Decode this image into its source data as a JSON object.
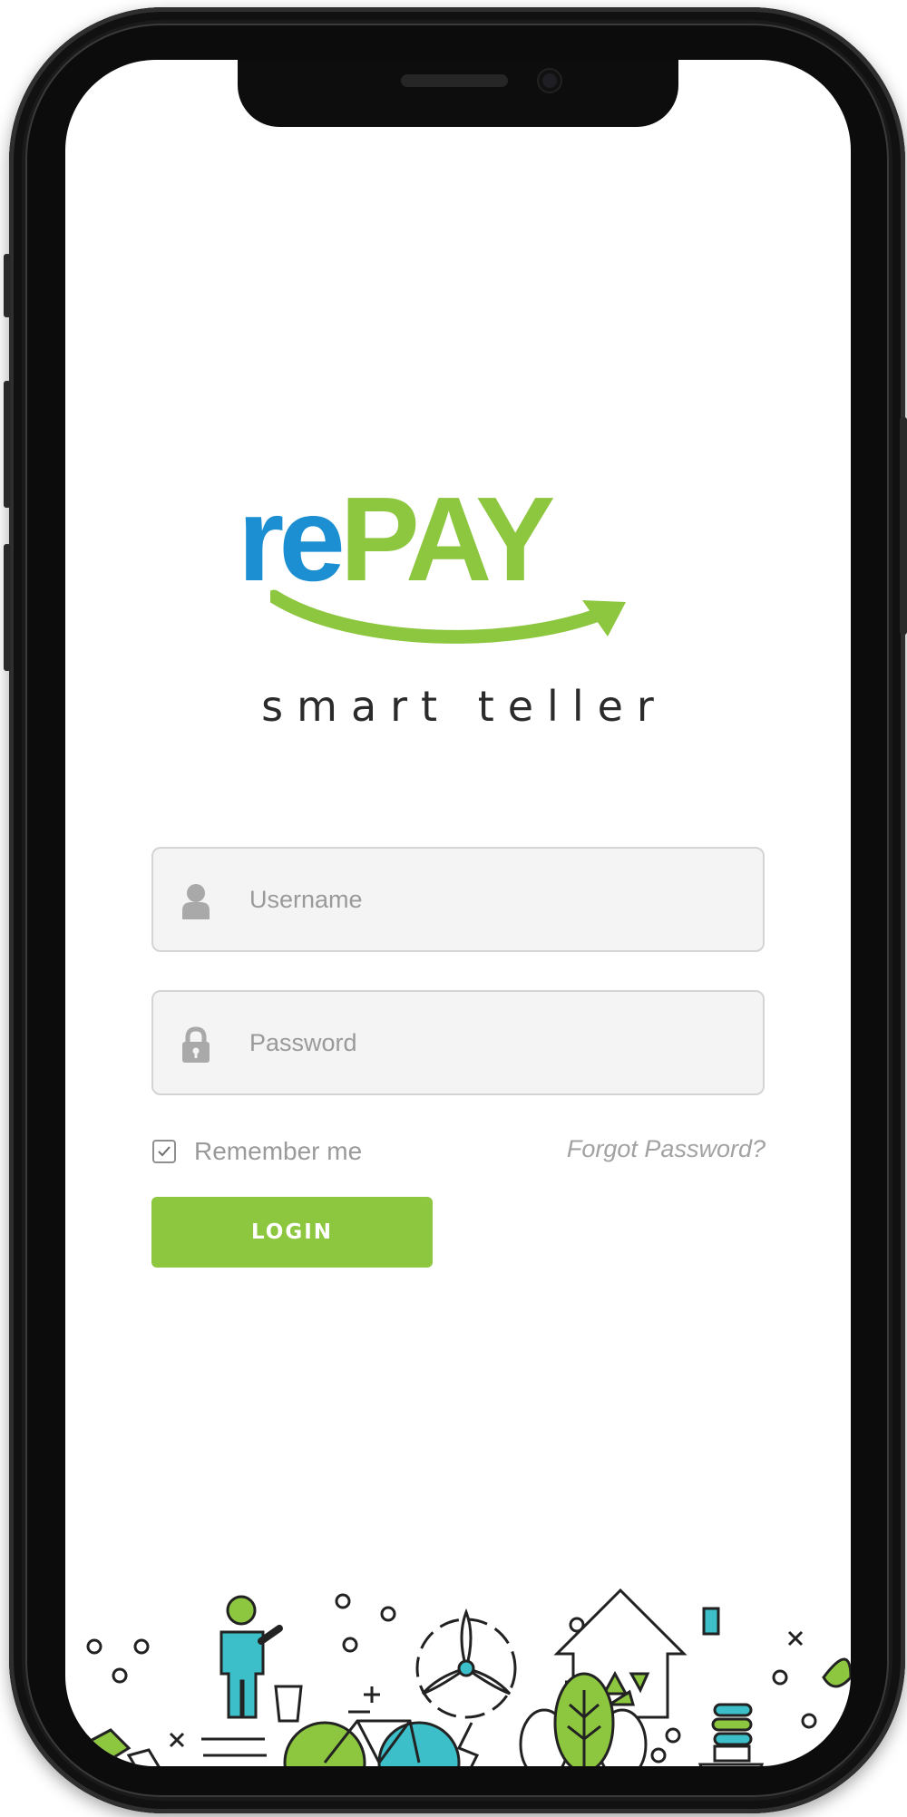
{
  "app": {
    "logo_text": "rePAY",
    "tagline": "smart teller"
  },
  "login_form": {
    "username": {
      "placeholder": "Username",
      "value": "",
      "icon": "user-icon"
    },
    "password": {
      "placeholder": "Password",
      "value": "",
      "icon": "lock-icon"
    },
    "remember_me": {
      "label": "Remember me",
      "checked": true
    },
    "forgot_password_label": "Forgot Password?",
    "login_label": "LOGIN"
  },
  "theme": {
    "blue": "#1b8fd2",
    "green": "#8dc63f",
    "teal": "#3cbfc8"
  }
}
